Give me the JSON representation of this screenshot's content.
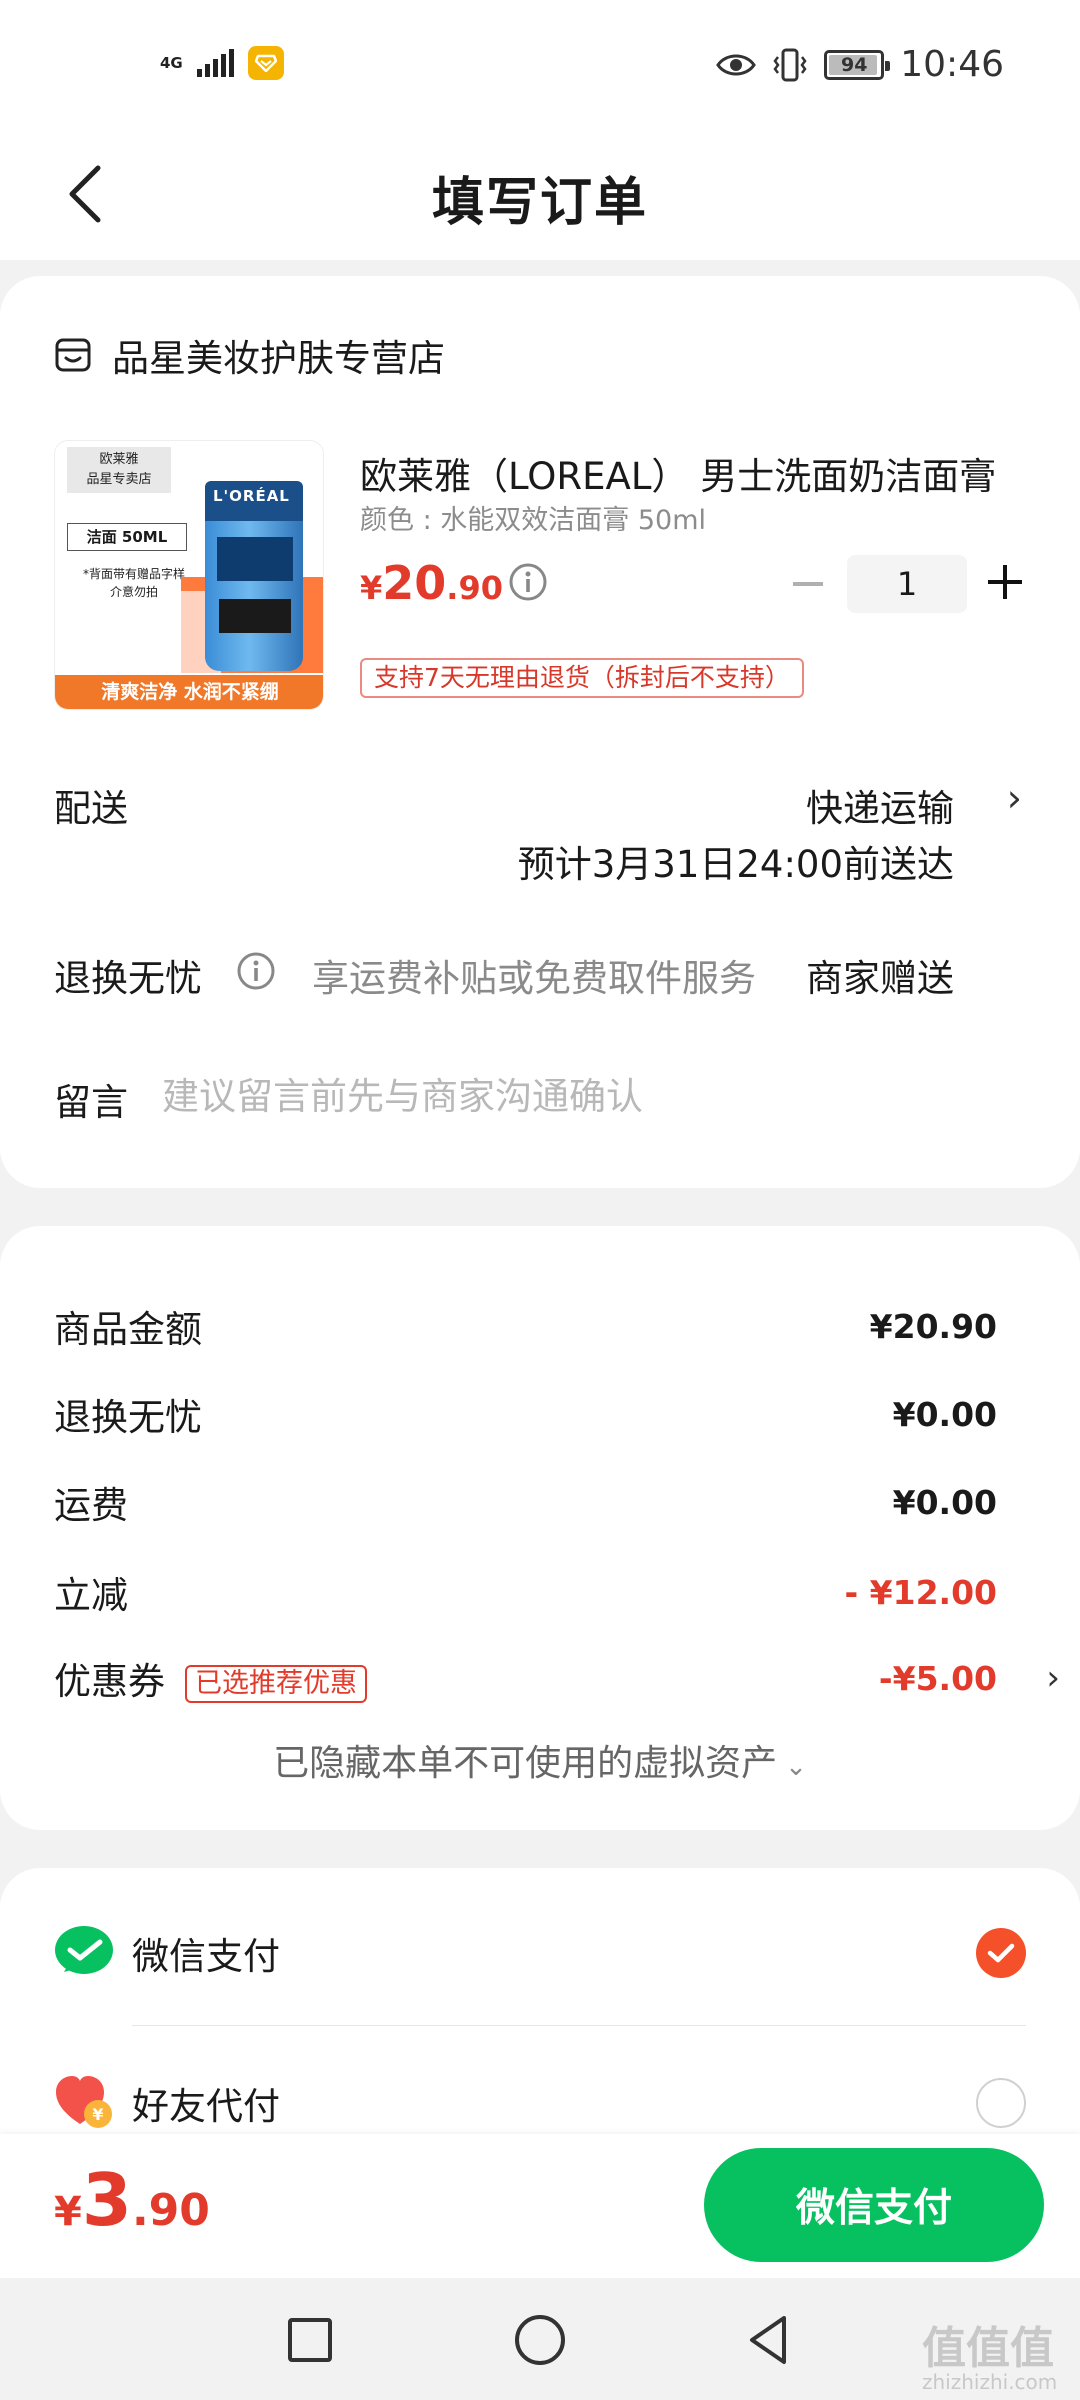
{
  "status_bar": {
    "network": "4G",
    "battery": "94",
    "time": "10:46"
  },
  "header": {
    "title": "填写订单"
  },
  "store": {
    "name": "品星美妆护肤专营店"
  },
  "product": {
    "image_top_text": "欧莱雅\n品星专卖店",
    "image_size_text": "洁面 50ML",
    "image_note": "*背面带有赠品字样\n介意勿拍",
    "image_brand": "L'ORÉAL",
    "image_banner": "清爽洁净 水润不紧绷",
    "title": "欧莱雅（LOREAL） 男士洗面奶洁面膏",
    "variant": "颜色 : 水能双效洁面膏 50ml",
    "price_symbol": "¥",
    "price_int": "20",
    "price_dec": ".90",
    "quantity": "1",
    "return_policy": "支持7天无理由退货（拆封后不支持）"
  },
  "shipping": {
    "label": "配送",
    "method": "快递运输",
    "eta": "预计3月31日24:00前送达"
  },
  "return_worry": {
    "label": "退换无忧",
    "desc": "享运费补贴或免费取件服务",
    "value": "商家赠送"
  },
  "message": {
    "label": "留言",
    "placeholder": "建议留言前先与商家沟通确认"
  },
  "summary": {
    "goods_label": "商品金额",
    "goods_amount": "¥20.90",
    "worry_label": "退换无忧",
    "worry_amount": "¥0.00",
    "freight_label": "运费",
    "freight_amount": "¥0.00",
    "discount_label": "立减",
    "discount_amount": "- ¥12.00",
    "coupon_label": "优惠券",
    "coupon_badge": "已选推荐优惠",
    "coupon_amount": "-¥5.00",
    "hidden_assets": "已隐藏本单不可使用的虚拟资产"
  },
  "payment": {
    "options": [
      {
        "label": "微信支付",
        "selected": true
      },
      {
        "label": "好友代付",
        "selected": false
      }
    ]
  },
  "bottom": {
    "total_symbol": "¥",
    "total_int": "3",
    "total_dec": ".90",
    "pay_button": "微信支付"
  },
  "watermark": {
    "main": "值值值",
    "sub": "zhizhizhi.com"
  },
  "colors": {
    "accent_red": "#e23b2b",
    "wechat_green": "#07c160",
    "radio_selected": "#f4502a"
  }
}
